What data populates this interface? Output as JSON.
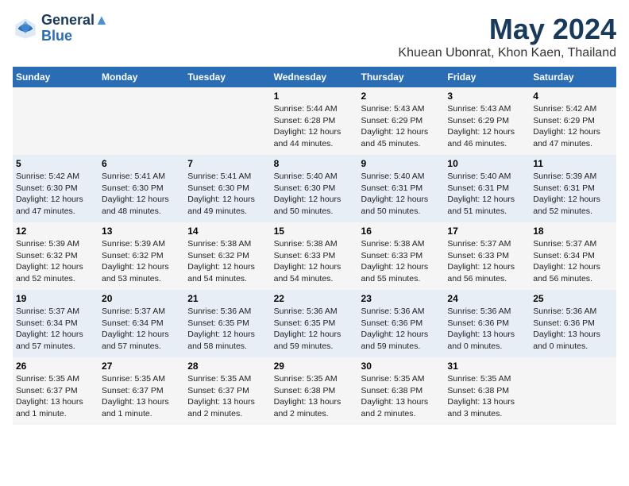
{
  "header": {
    "logo_line1": "General",
    "logo_line2": "Blue",
    "main_title": "May 2024",
    "subtitle": "Khuean Ubonrat, Khon Kaen, Thailand"
  },
  "days_of_week": [
    "Sunday",
    "Monday",
    "Tuesday",
    "Wednesday",
    "Thursday",
    "Friday",
    "Saturday"
  ],
  "weeks": [
    [
      {
        "day": "",
        "info": ""
      },
      {
        "day": "",
        "info": ""
      },
      {
        "day": "",
        "info": ""
      },
      {
        "day": "1",
        "info": "Sunrise: 5:44 AM\nSunset: 6:28 PM\nDaylight: 12 hours\nand 44 minutes."
      },
      {
        "day": "2",
        "info": "Sunrise: 5:43 AM\nSunset: 6:29 PM\nDaylight: 12 hours\nand 45 minutes."
      },
      {
        "day": "3",
        "info": "Sunrise: 5:43 AM\nSunset: 6:29 PM\nDaylight: 12 hours\nand 46 minutes."
      },
      {
        "day": "4",
        "info": "Sunrise: 5:42 AM\nSunset: 6:29 PM\nDaylight: 12 hours\nand 47 minutes."
      }
    ],
    [
      {
        "day": "5",
        "info": "Sunrise: 5:42 AM\nSunset: 6:30 PM\nDaylight: 12 hours\nand 47 minutes."
      },
      {
        "day": "6",
        "info": "Sunrise: 5:41 AM\nSunset: 6:30 PM\nDaylight: 12 hours\nand 48 minutes."
      },
      {
        "day": "7",
        "info": "Sunrise: 5:41 AM\nSunset: 6:30 PM\nDaylight: 12 hours\nand 49 minutes."
      },
      {
        "day": "8",
        "info": "Sunrise: 5:40 AM\nSunset: 6:30 PM\nDaylight: 12 hours\nand 50 minutes."
      },
      {
        "day": "9",
        "info": "Sunrise: 5:40 AM\nSunset: 6:31 PM\nDaylight: 12 hours\nand 50 minutes."
      },
      {
        "day": "10",
        "info": "Sunrise: 5:40 AM\nSunset: 6:31 PM\nDaylight: 12 hours\nand 51 minutes."
      },
      {
        "day": "11",
        "info": "Sunrise: 5:39 AM\nSunset: 6:31 PM\nDaylight: 12 hours\nand 52 minutes."
      }
    ],
    [
      {
        "day": "12",
        "info": "Sunrise: 5:39 AM\nSunset: 6:32 PM\nDaylight: 12 hours\nand 52 minutes."
      },
      {
        "day": "13",
        "info": "Sunrise: 5:39 AM\nSunset: 6:32 PM\nDaylight: 12 hours\nand 53 minutes."
      },
      {
        "day": "14",
        "info": "Sunrise: 5:38 AM\nSunset: 6:32 PM\nDaylight: 12 hours\nand 54 minutes."
      },
      {
        "day": "15",
        "info": "Sunrise: 5:38 AM\nSunset: 6:33 PM\nDaylight: 12 hours\nand 54 minutes."
      },
      {
        "day": "16",
        "info": "Sunrise: 5:38 AM\nSunset: 6:33 PM\nDaylight: 12 hours\nand 55 minutes."
      },
      {
        "day": "17",
        "info": "Sunrise: 5:37 AM\nSunset: 6:33 PM\nDaylight: 12 hours\nand 56 minutes."
      },
      {
        "day": "18",
        "info": "Sunrise: 5:37 AM\nSunset: 6:34 PM\nDaylight: 12 hours\nand 56 minutes."
      }
    ],
    [
      {
        "day": "19",
        "info": "Sunrise: 5:37 AM\nSunset: 6:34 PM\nDaylight: 12 hours\nand 57 minutes."
      },
      {
        "day": "20",
        "info": "Sunrise: 5:37 AM\nSunset: 6:34 PM\nDaylight: 12 hours\nand 57 minutes."
      },
      {
        "day": "21",
        "info": "Sunrise: 5:36 AM\nSunset: 6:35 PM\nDaylight: 12 hours\nand 58 minutes."
      },
      {
        "day": "22",
        "info": "Sunrise: 5:36 AM\nSunset: 6:35 PM\nDaylight: 12 hours\nand 59 minutes."
      },
      {
        "day": "23",
        "info": "Sunrise: 5:36 AM\nSunset: 6:36 PM\nDaylight: 12 hours\nand 59 minutes."
      },
      {
        "day": "24",
        "info": "Sunrise: 5:36 AM\nSunset: 6:36 PM\nDaylight: 13 hours\nand 0 minutes."
      },
      {
        "day": "25",
        "info": "Sunrise: 5:36 AM\nSunset: 6:36 PM\nDaylight: 13 hours\nand 0 minutes."
      }
    ],
    [
      {
        "day": "26",
        "info": "Sunrise: 5:35 AM\nSunset: 6:37 PM\nDaylight: 13 hours\nand 1 minute."
      },
      {
        "day": "27",
        "info": "Sunrise: 5:35 AM\nSunset: 6:37 PM\nDaylight: 13 hours\nand 1 minute."
      },
      {
        "day": "28",
        "info": "Sunrise: 5:35 AM\nSunset: 6:37 PM\nDaylight: 13 hours\nand 2 minutes."
      },
      {
        "day": "29",
        "info": "Sunrise: 5:35 AM\nSunset: 6:38 PM\nDaylight: 13 hours\nand 2 minutes."
      },
      {
        "day": "30",
        "info": "Sunrise: 5:35 AM\nSunset: 6:38 PM\nDaylight: 13 hours\nand 2 minutes."
      },
      {
        "day": "31",
        "info": "Sunrise: 5:35 AM\nSunset: 6:38 PM\nDaylight: 13 hours\nand 3 minutes."
      },
      {
        "day": "",
        "info": ""
      }
    ]
  ]
}
